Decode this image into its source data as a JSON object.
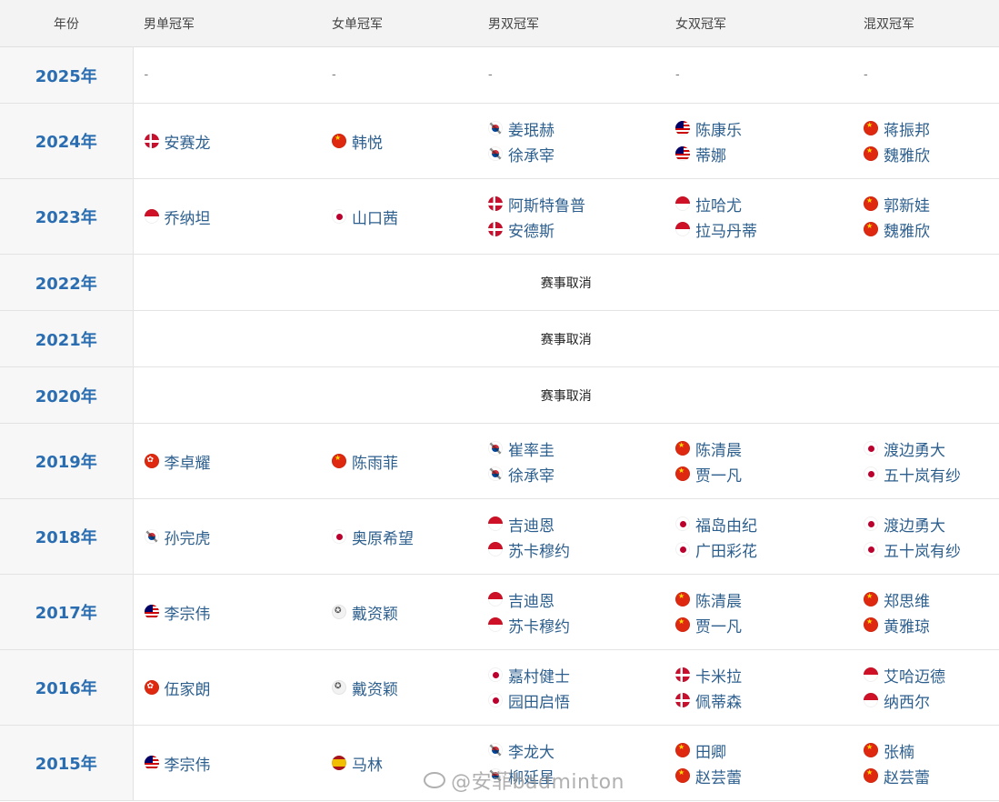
{
  "headers": [
    "年份",
    "男单冠军",
    "女单冠军",
    "男双冠军",
    "女双冠军",
    "混双冠军"
  ],
  "empty_marker": "-",
  "rows": [
    {
      "year": "2025年",
      "empty": true
    },
    {
      "year": "2024年",
      "ms": [
        {
          "flag": "dk",
          "name": "安赛龙"
        }
      ],
      "ws": [
        {
          "flag": "cn",
          "name": "韩悦"
        }
      ],
      "md": [
        {
          "flag": "kr",
          "name": "姜珉赫"
        },
        {
          "flag": "kr",
          "name": "徐承宰"
        }
      ],
      "wd": [
        {
          "flag": "my",
          "name": "陈康乐"
        },
        {
          "flag": "my",
          "name": "蒂娜"
        }
      ],
      "xd": [
        {
          "flag": "cn",
          "name": "蒋振邦"
        },
        {
          "flag": "cn",
          "name": "魏雅欣"
        }
      ]
    },
    {
      "year": "2023年",
      "ms": [
        {
          "flag": "id",
          "name": "乔纳坦"
        }
      ],
      "ws": [
        {
          "flag": "jp",
          "name": "山口茜"
        }
      ],
      "md": [
        {
          "flag": "dk",
          "name": "阿斯特鲁普"
        },
        {
          "flag": "dk",
          "name": "安德斯"
        }
      ],
      "wd": [
        {
          "flag": "id",
          "name": "拉哈尤"
        },
        {
          "flag": "id",
          "name": "拉马丹蒂"
        }
      ],
      "xd": [
        {
          "flag": "cn",
          "name": "郭新娃"
        },
        {
          "flag": "cn",
          "name": "魏雅欣"
        }
      ]
    },
    {
      "year": "2022年",
      "cancelled": "赛事取消"
    },
    {
      "year": "2021年",
      "cancelled": "赛事取消"
    },
    {
      "year": "2020年",
      "cancelled": "赛事取消"
    },
    {
      "year": "2019年",
      "ms": [
        {
          "flag": "hk",
          "name": "李卓耀"
        }
      ],
      "ws": [
        {
          "flag": "cn",
          "name": "陈雨菲"
        }
      ],
      "md": [
        {
          "flag": "kr",
          "name": "崔率圭"
        },
        {
          "flag": "kr",
          "name": "徐承宰"
        }
      ],
      "wd": [
        {
          "flag": "cn",
          "name": "陈清晨"
        },
        {
          "flag": "cn",
          "name": "贾一凡"
        }
      ],
      "xd": [
        {
          "flag": "jp",
          "name": "渡边勇大"
        },
        {
          "flag": "jp",
          "name": "五十岚有纱"
        }
      ]
    },
    {
      "year": "2018年",
      "ms": [
        {
          "flag": "kr",
          "name": "孙完虎"
        }
      ],
      "ws": [
        {
          "flag": "jp",
          "name": "奥原希望"
        }
      ],
      "md": [
        {
          "flag": "id",
          "name": "吉迪恩"
        },
        {
          "flag": "id",
          "name": "苏卡穆约"
        }
      ],
      "wd": [
        {
          "flag": "jp",
          "name": "福岛由纪"
        },
        {
          "flag": "jp",
          "name": "广田彩花"
        }
      ],
      "xd": [
        {
          "flag": "jp",
          "name": "渡边勇大"
        },
        {
          "flag": "jp",
          "name": "五十岚有纱"
        }
      ]
    },
    {
      "year": "2017年",
      "ms": [
        {
          "flag": "my",
          "name": "李宗伟"
        }
      ],
      "ws": [
        {
          "flag": "tw",
          "name": "戴资颖"
        }
      ],
      "md": [
        {
          "flag": "id",
          "name": "吉迪恩"
        },
        {
          "flag": "id",
          "name": "苏卡穆约"
        }
      ],
      "wd": [
        {
          "flag": "cn",
          "name": "陈清晨"
        },
        {
          "flag": "cn",
          "name": "贾一凡"
        }
      ],
      "xd": [
        {
          "flag": "cn",
          "name": "郑思维"
        },
        {
          "flag": "cn",
          "name": "黄雅琼"
        }
      ]
    },
    {
      "year": "2016年",
      "ms": [
        {
          "flag": "hk",
          "name": "伍家朗"
        }
      ],
      "ws": [
        {
          "flag": "tw",
          "name": "戴资颖"
        }
      ],
      "md": [
        {
          "flag": "jp",
          "name": "嘉村健士"
        },
        {
          "flag": "jp",
          "name": "园田启悟"
        }
      ],
      "wd": [
        {
          "flag": "dk",
          "name": "卡米拉"
        },
        {
          "flag": "dk",
          "name": "佩蒂森"
        }
      ],
      "xd": [
        {
          "flag": "id",
          "name": "艾哈迈德"
        },
        {
          "flag": "id",
          "name": "纳西尔"
        }
      ]
    },
    {
      "year": "2015年",
      "ms": [
        {
          "flag": "my",
          "name": "李宗伟"
        }
      ],
      "ws": [
        {
          "flag": "es",
          "name": "马林"
        }
      ],
      "md": [
        {
          "flag": "kr",
          "name": "李龙大"
        },
        {
          "flag": "kr",
          "name": "柳延星"
        }
      ],
      "wd": [
        {
          "flag": "cn",
          "name": "田卿"
        },
        {
          "flag": "cn",
          "name": "赵芸蕾"
        }
      ],
      "xd": [
        {
          "flag": "cn",
          "name": "张楠"
        },
        {
          "flag": "cn",
          "name": "赵芸蕾"
        }
      ]
    }
  ],
  "watermark_text": "@安菲badminton"
}
